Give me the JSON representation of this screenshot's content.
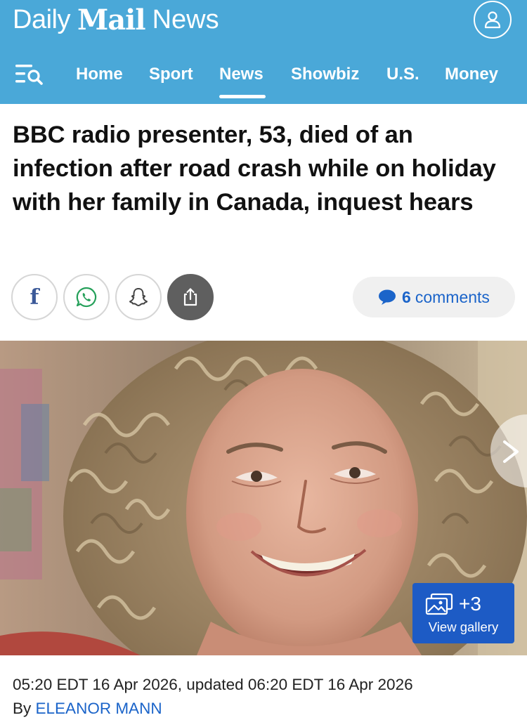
{
  "header": {
    "brand": {
      "part1": "Daily",
      "part2": "Mail",
      "part3": "News"
    },
    "background_color": "#4aa8d8",
    "account_icon": "user-icon",
    "menu_icon": "menu-search-icon",
    "nav": [
      {
        "label": "Home"
      },
      {
        "label": "Sport"
      },
      {
        "label": "News",
        "active": true
      },
      {
        "label": "Showbiz"
      },
      {
        "label": "U.S."
      },
      {
        "label": "Money"
      }
    ]
  },
  "article": {
    "headline": "BBC radio presenter, 53, died of an infection after road crash while on holiday with her family in Canada, inquest hears",
    "share": [
      {
        "icon": "facebook-icon",
        "glyph": "f"
      },
      {
        "icon": "whatsapp-icon"
      },
      {
        "icon": "snapchat-icon"
      },
      {
        "icon": "share-icon"
      }
    ],
    "comments": {
      "count": "6",
      "label": "comments",
      "icon": "comment-bubble-icon",
      "color": "#1b64c9"
    },
    "gallery": {
      "count": "+3",
      "label": "View gallery",
      "color": "#1d5bc5"
    },
    "dateline": "05:20 EDT 16 Apr 2026, updated 06:20 EDT 16 Apr 2026",
    "byline": {
      "prefix": "By",
      "author": "ELEANOR MANN"
    }
  }
}
